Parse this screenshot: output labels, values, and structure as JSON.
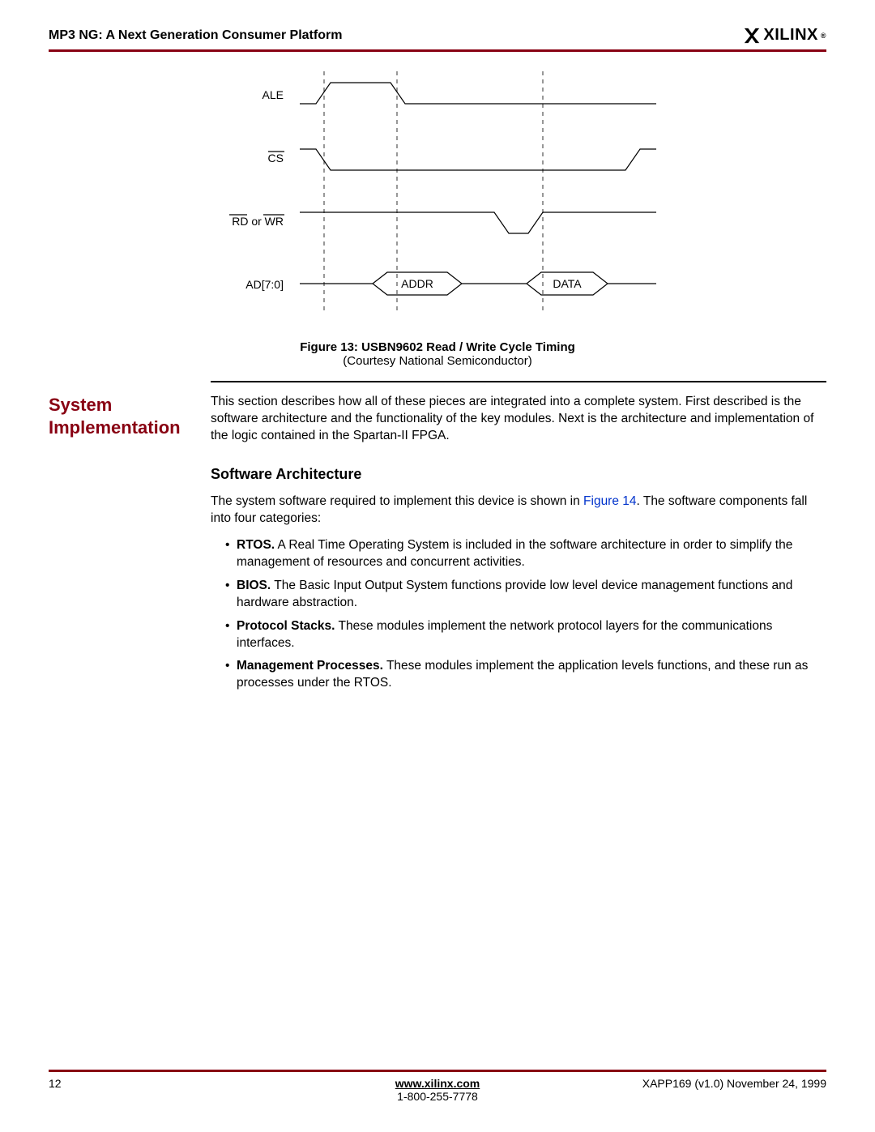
{
  "header": {
    "title": "MP3 NG: A Next Generation Consumer Platform",
    "logo_text": "XILINX"
  },
  "figure": {
    "signals": {
      "ale": "ALE",
      "cs": "CS",
      "rdwr_rd": "RD",
      "rdwr_or": " or ",
      "rdwr_wr": "WR",
      "ad": "AD[7:0]",
      "addr": "ADDR",
      "data": "DATA"
    },
    "caption_label": "Figure 13:  USBN9602 Read / Write Cycle Timing",
    "caption_sub": "(Courtesy National Semiconductor)"
  },
  "section": {
    "heading": "System Implementation",
    "intro": "This section describes how all of these pieces are integrated into a complete system. First described is the software architecture and the functionality of the key modules. Next is the architecture and implementation of the logic contained in the Spartan-II FPGA.",
    "subhead": "Software Architecture",
    "para2_before": "The system software required to implement this device is shown in ",
    "para2_link": "Figure 14",
    "para2_after": ". The software components fall into four categories:",
    "bullets": [
      {
        "term": "RTOS.",
        "text": " A Real Time Operating System is included in the software architecture in order to simplify the management of resources and concurrent activities."
      },
      {
        "term": "BIOS.",
        "text": " The Basic Input Output System functions provide low level device management functions and hardware abstraction."
      },
      {
        "term": "Protocol Stacks.",
        "text": " These modules implement the network protocol layers for the communications interfaces."
      },
      {
        "term": "Management Processes.",
        "text": " These modules implement the application levels functions, and these run as processes under the RTOS."
      }
    ]
  },
  "footer": {
    "page": "12",
    "url": "www.xilinx.com",
    "phone": "1-800-255-7778",
    "meta": "XAPP169 (v1.0) November 24, 1999"
  }
}
